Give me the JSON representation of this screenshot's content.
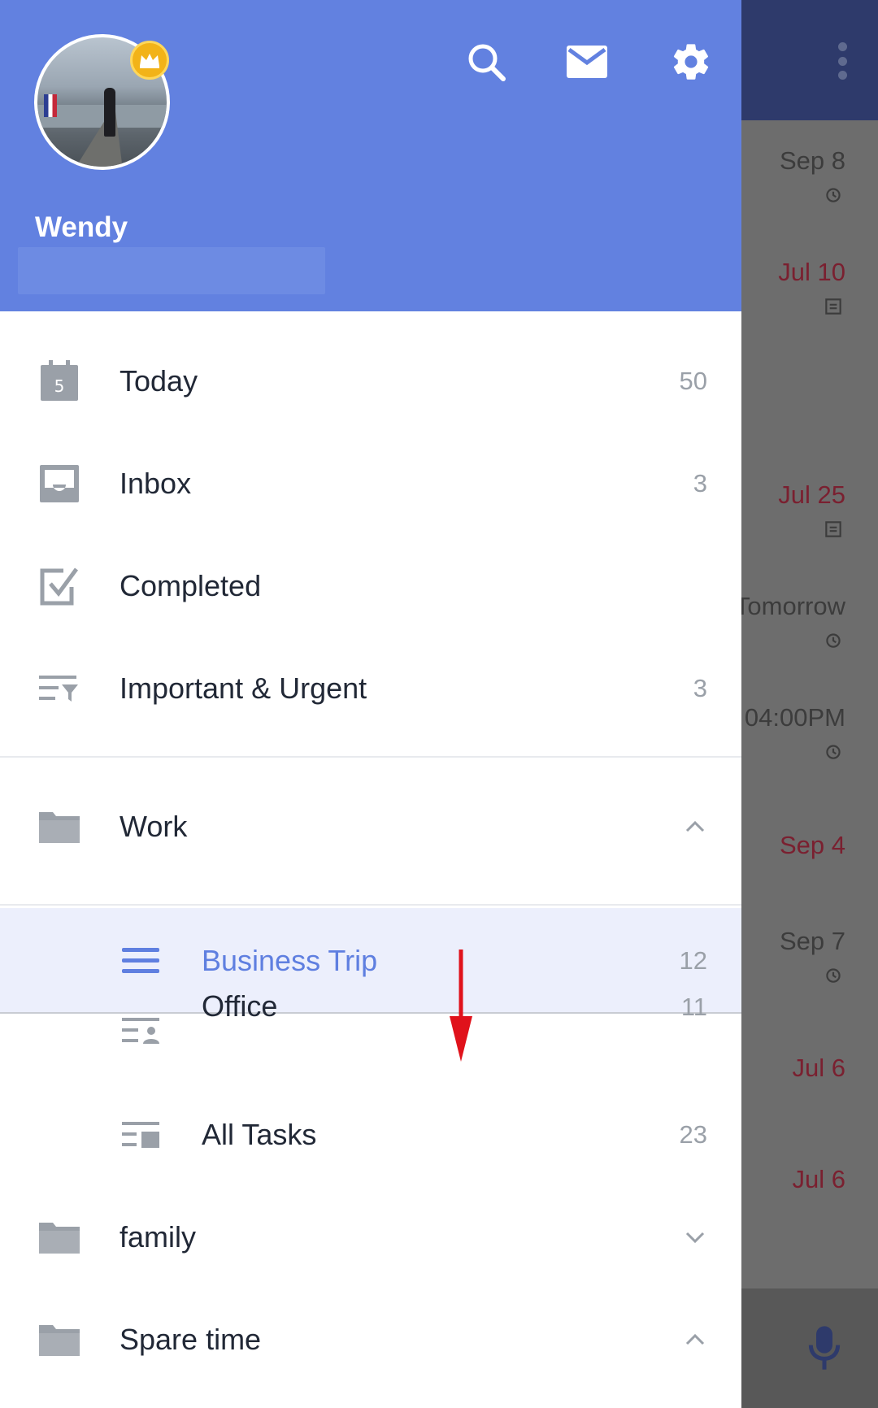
{
  "header": {
    "user_name": "Wendy",
    "icons": [
      "search-icon",
      "mail-icon",
      "settings-icon"
    ],
    "badge": "crown-icon"
  },
  "menu": [
    {
      "label": "Today",
      "count": "50",
      "icon": "calendar-icon",
      "calendar_day": "5"
    },
    {
      "label": "Inbox",
      "count": "3",
      "icon": "inbox-icon"
    },
    {
      "label": "Completed",
      "count": "",
      "icon": "checkbox-icon"
    },
    {
      "label": "Important & Urgent",
      "count": "3",
      "icon": "filter-list-icon"
    }
  ],
  "folders": {
    "work": {
      "label": "Work",
      "state": "expanded"
    },
    "family": {
      "label": "family",
      "state": "collapsed"
    },
    "spare": {
      "label": "Spare time",
      "state": "expanded"
    }
  },
  "work_lists": [
    {
      "label": "Business Trip",
      "count": "12",
      "icon": "list-icon",
      "selected": true
    },
    {
      "label": "Office",
      "count": "11",
      "icon": "office-list-icon"
    },
    {
      "label": "All Tasks",
      "count": "23",
      "icon": "all-tasks-icon"
    }
  ],
  "background_dates": [
    {
      "text": "Sep 8",
      "tone": "gray",
      "sub_icon": "alarm-icon"
    },
    {
      "text": "Jul 10",
      "tone": "red",
      "sub_icon": "note-icon"
    },
    {
      "text": "Jul 25",
      "tone": "red",
      "sub_icon": "note-icon"
    },
    {
      "text": "Tomorrow",
      "tone": "gray",
      "sub_icon": "alarm-icon"
    },
    {
      "text": "04:00PM",
      "tone": "gray",
      "sub_icon": "alarm-icon"
    },
    {
      "text": "Sep 4",
      "tone": "red",
      "sub_icon": ""
    },
    {
      "text": "Sep 7",
      "tone": "gray",
      "sub_icon": "alarm-icon"
    },
    {
      "text": "Jul 6",
      "tone": "red",
      "sub_icon": ""
    },
    {
      "text": "Jul 6",
      "tone": "red",
      "sub_icon": ""
    }
  ],
  "colors": {
    "header": "#6281e0",
    "selected_text": "#5f7fe0",
    "annotation_arrow": "#e0121b"
  }
}
